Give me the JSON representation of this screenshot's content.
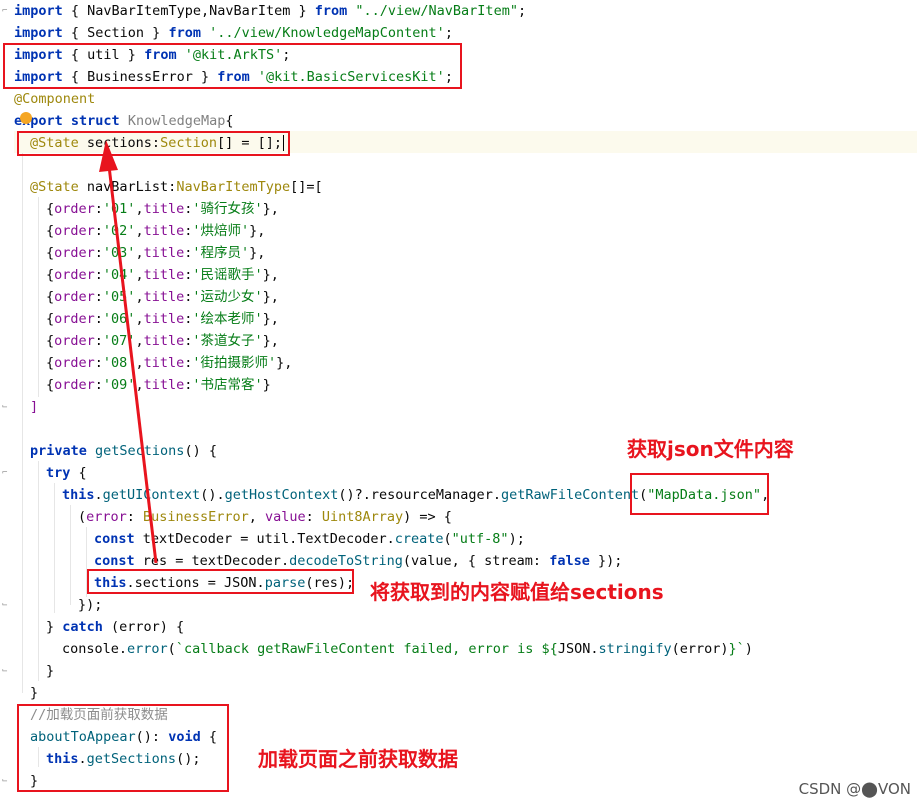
{
  "code": {
    "l1": {
      "kw1": "import",
      "t1": " { NavBarItemType,NavBarItem } ",
      "kw2": "from",
      "s": " \"../view/NavBarItem\"",
      "t2": ";"
    },
    "l2": {
      "kw1": "import",
      "t1": " { Section } ",
      "kw2": "from",
      "s": " '../view/KnowledgeMapContent'",
      "t2": ";"
    },
    "l3": {
      "kw1": "import",
      "t1": " { util } ",
      "kw2": "from",
      "s": " '@kit.ArkTS'",
      "t2": ";"
    },
    "l4": {
      "kw1": "import",
      "t1": " { BusinessError } ",
      "kw2": "from",
      "s": " '@kit.BasicServicesKit'",
      "t2": ";"
    },
    "l5": {
      "ann": "@Component"
    },
    "l6": {
      "kw1": "export",
      "kw2": " struct",
      "t1": " ",
      "cls": "KnowledgeMap",
      "t2": "{"
    },
    "l7": {
      "ann": "@State",
      "t1": " sections:",
      "type": "Section",
      "t2": "[] = [];"
    },
    "l8": {
      "ann": "@State",
      "t1": " navBarList:",
      "type": "NavBarItemType",
      "t2": "[]=["
    },
    "items": [
      {
        "order": "'01'",
        "title": "'骑行女孩'"
      },
      {
        "order": "'02'",
        "title": "'烘焙师'"
      },
      {
        "order": "'03'",
        "title": "'程序员'"
      },
      {
        "order": "'04'",
        "title": "'民谣歌手'"
      },
      {
        "order": "'05'",
        "title": "'运动少女'"
      },
      {
        "order": "'06'",
        "title": "'绘本老师'"
      },
      {
        "order": "'07'",
        "title": "'茶道女子'"
      },
      {
        "order": "'08'",
        "title": "'街拍摄影师'"
      },
      {
        "order": "'09'",
        "title": "'书店常客'"
      }
    ],
    "close_bracket": "]",
    "l_fn": {
      "kw": "private",
      "fn": " getSections",
      "t": "() {"
    },
    "l_try": {
      "kw": "try",
      "t": " {"
    },
    "l_call": {
      "kw": "this",
      "t1": ".",
      "fn1": "getUIContext",
      "t2": "().",
      "fn2": "getHostContext",
      "t3": "()?.resourceManager.",
      "fn3": "getRawFileContent",
      "t4": "(",
      "s": "\"MapData.json\"",
      "t5": ","
    },
    "l_cb": {
      "t1": "(",
      "p1": "error",
      "t2": ": ",
      "type1": "BusinessError",
      "t3": ", ",
      "p2": "value",
      "t4": ": ",
      "type2": "Uint8Array",
      "t5": ") => {"
    },
    "l_dec": {
      "kw": "const",
      "t1": " textDecoder = util.TextDecoder.",
      "fn": "create",
      "t2": "(",
      "s": "\"utf-8\"",
      "t3": ");"
    },
    "l_res": {
      "kw": "const",
      "t1": " res = textDecoder.",
      "fn": "decodeToString",
      "t2": "(value, { stream: ",
      "kw2": "false",
      "t3": " });"
    },
    "l_assign": {
      "kw": "this",
      "t1": ".sections = JSON.",
      "fn": "parse",
      "t2": "(res);"
    },
    "l_close_cb": "});",
    "l_catch": {
      "t1": "} ",
      "kw": "catch",
      "t2": " (error) {"
    },
    "l_console": {
      "t1": "console.",
      "fn": "error",
      "t2": "(",
      "s": "`callback getRawFileContent failed, error is ${",
      "t3": "JSON.",
      "fn2": "stringify",
      "t4": "(error)",
      "s2": "}`",
      "t5": ")"
    },
    "close1": "}",
    "close2": "}",
    "comment": "//加载页面前获取数据",
    "l_about": {
      "fn": "aboutToAppear",
      "t1": "(): ",
      "kw": "void",
      "t2": " {"
    },
    "l_this_get": {
      "kw": "this",
      "t1": ".",
      "fn": "getSections",
      "t2": "();"
    },
    "close3": "}"
  },
  "annotations": {
    "get_json": "获取json文件内容",
    "assign": "将获取到的内容赋值给sections",
    "load_before": "加载页面之前获取数据"
  },
  "watermark": "CSDN @⬤VON",
  "colors": {
    "annotation_red": "#e8141e",
    "keyword": "#0033b3",
    "string": "#067d17"
  }
}
